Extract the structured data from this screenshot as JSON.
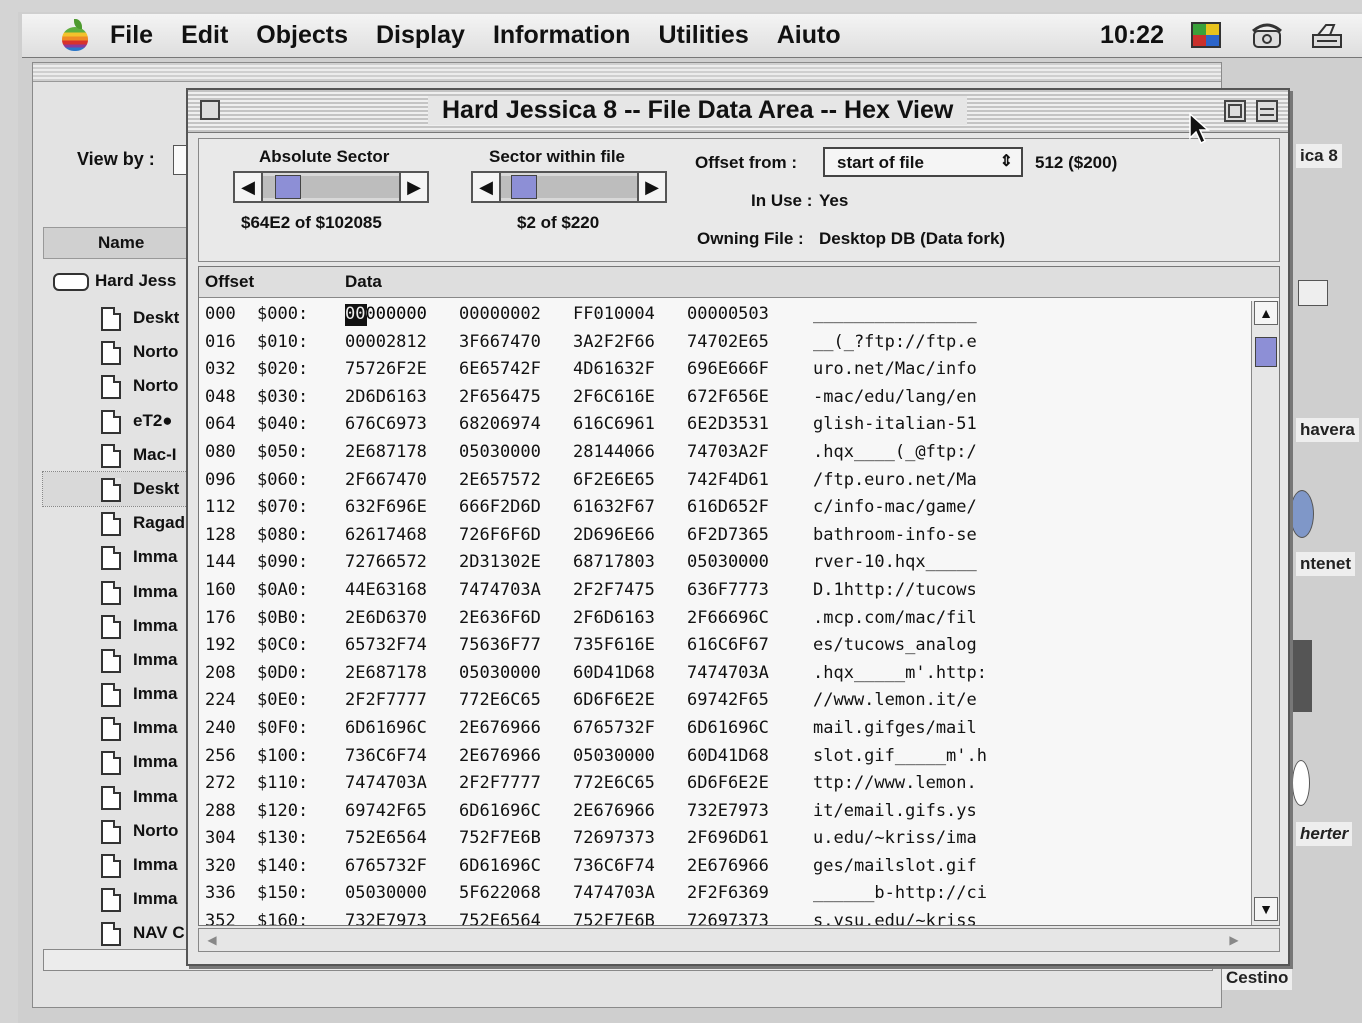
{
  "menubar": {
    "items": [
      "File",
      "Edit",
      "Objects",
      "Display",
      "Information",
      "Utilities",
      "Aiuto"
    ],
    "clock": "10:22",
    "icons": [
      "apple-icon",
      "color-flag-icon",
      "telephone-icon",
      "printer-icon"
    ]
  },
  "finder": {
    "view_by_label": "View by :",
    "name_header": "Name",
    "disk_label": "Hard Jess",
    "files": [
      "Deskt",
      "Norto",
      "Norto",
      "eT2●",
      "Mac-I",
      "Deskt",
      "Ragad",
      "Imma",
      "Imma",
      "Imma",
      "Imma",
      "Imma",
      "Imma",
      "Imma",
      "Imma",
      "Norto",
      "Imma",
      "Imma",
      "NAV C"
    ]
  },
  "desktop": {
    "labels": [
      "ica 8",
      "havera",
      "ntenet",
      "herter",
      "Cestino"
    ]
  },
  "hexwin": {
    "title": "Hard Jessica 8 -- File Data Area -- Hex View",
    "absolute_sector_label": "Absolute Sector",
    "absolute_sector_value": "$64E2 of $102085",
    "sector_within_label": "Sector within file",
    "sector_within_value": "$2 of $220",
    "offset_from_label": "Offset from :",
    "offset_from_value": "start of file",
    "offset_value": "512 ($200)",
    "in_use_label": "In Use :",
    "in_use_value": "Yes",
    "owning_file_label": "Owning File :",
    "owning_file_value": "Desktop DB (Data fork)",
    "col_offset": "Offset",
    "col_data": "Data",
    "rows": [
      {
        "off": "000",
        "sec": "$000:",
        "w": [
          "00000000",
          "00000002",
          "FF010004",
          "00000503"
        ],
        "a": "________________"
      },
      {
        "off": "016",
        "sec": "$010:",
        "w": [
          "00002812",
          "3F667470",
          "3A2F2F66",
          "74702E65"
        ],
        "a": "__(_?ftp://ftp.e"
      },
      {
        "off": "032",
        "sec": "$020:",
        "w": [
          "75726F2E",
          "6E65742F",
          "4D61632F",
          "696E666F"
        ],
        "a": "uro.net/Mac/info"
      },
      {
        "off": "048",
        "sec": "$030:",
        "w": [
          "2D6D6163",
          "2F656475",
          "2F6C616E",
          "672F656E"
        ],
        "a": "-mac/edu/lang/en"
      },
      {
        "off": "064",
        "sec": "$040:",
        "w": [
          "676C6973",
          "68206974",
          "616C6961",
          "6E2D3531"
        ],
        "a": "glish-italian-51"
      },
      {
        "off": "080",
        "sec": "$050:",
        "w": [
          "2E687178",
          "05030000",
          "28144066",
          "74703A2F"
        ],
        "a": ".hqx____(_@ftp:/"
      },
      {
        "off": "096",
        "sec": "$060:",
        "w": [
          "2F667470",
          "2E657572",
          "6F2E6E65",
          "742F4D61"
        ],
        "a": "/ftp.euro.net/Ma"
      },
      {
        "off": "112",
        "sec": "$070:",
        "w": [
          "632F696E",
          "666F2D6D",
          "61632F67",
          "616D652F"
        ],
        "a": "c/info-mac/game/"
      },
      {
        "off": "128",
        "sec": "$080:",
        "w": [
          "62617468",
          "726F6F6D",
          "2D696E66",
          "6F2D7365"
        ],
        "a": "bathroom-info-se"
      },
      {
        "off": "144",
        "sec": "$090:",
        "w": [
          "72766572",
          "2D31302E",
          "68717803",
          "05030000"
        ],
        "a": "rver-10.hqx_____"
      },
      {
        "off": "160",
        "sec": "$0A0:",
        "w": [
          "44E63168",
          "7474703A",
          "2F2F7475",
          "636F7773"
        ],
        "a": "D.1http://tucows"
      },
      {
        "off": "176",
        "sec": "$0B0:",
        "w": [
          "2E6D6370",
          "2E636F6D",
          "2F6D6163",
          "2F66696C"
        ],
        "a": ".mcp.com/mac/fil"
      },
      {
        "off": "192",
        "sec": "$0C0:",
        "w": [
          "65732F74",
          "75636F77",
          "735F616E",
          "616C6F67"
        ],
        "a": "es/tucows_analog"
      },
      {
        "off": "208",
        "sec": "$0D0:",
        "w": [
          "2E687178",
          "05030000",
          "60D41D68",
          "7474703A"
        ],
        "a": ".hqx_____m'.http:"
      },
      {
        "off": "224",
        "sec": "$0E0:",
        "w": [
          "2F2F7777",
          "772E6C65",
          "6D6F6E2E",
          "69742F65"
        ],
        "a": "//www.lemon.it/e"
      },
      {
        "off": "240",
        "sec": "$0F0:",
        "w": [
          "6D61696C",
          "2E676966",
          "6765732F",
          "6D61696C"
        ],
        "a": "mail.gifges/mail"
      },
      {
        "off": "256",
        "sec": "$100:",
        "w": [
          "736C6F74",
          "2E676966",
          "05030000",
          "60D41D68"
        ],
        "a": "slot.gif_____m'.h"
      },
      {
        "off": "272",
        "sec": "$110:",
        "w": [
          "7474703A",
          "2F2F7777",
          "772E6C65",
          "6D6F6E2E"
        ],
        "a": "ttp://www.lemon."
      },
      {
        "off": "288",
        "sec": "$120:",
        "w": [
          "69742F65",
          "6D61696C",
          "2E676966",
          "732E7973"
        ],
        "a": "it/email.gifs.ys"
      },
      {
        "off": "304",
        "sec": "$130:",
        "w": [
          "752E6564",
          "752F7E6B",
          "72697373",
          "2F696D61"
        ],
        "a": "u.edu/~kriss/ima"
      },
      {
        "off": "320",
        "sec": "$140:",
        "w": [
          "6765732F",
          "6D61696C",
          "736C6F74",
          "2E676966"
        ],
        "a": "ges/mailslot.gif"
      },
      {
        "off": "336",
        "sec": "$150:",
        "w": [
          "05030000",
          "5F622068",
          "7474703A",
          "2F2F6369"
        ],
        "a": "______b-http://ci"
      },
      {
        "off": "352",
        "sec": "$160:",
        "w": [
          "732E7973",
          "752E6564",
          "752F7E6B",
          "72697373"
        ],
        "a": "s.ysu.edu/~kriss"
      }
    ]
  },
  "colors": {
    "selection_blue": "#8d8fd6",
    "chrome_gray": "#e6e6e6"
  }
}
